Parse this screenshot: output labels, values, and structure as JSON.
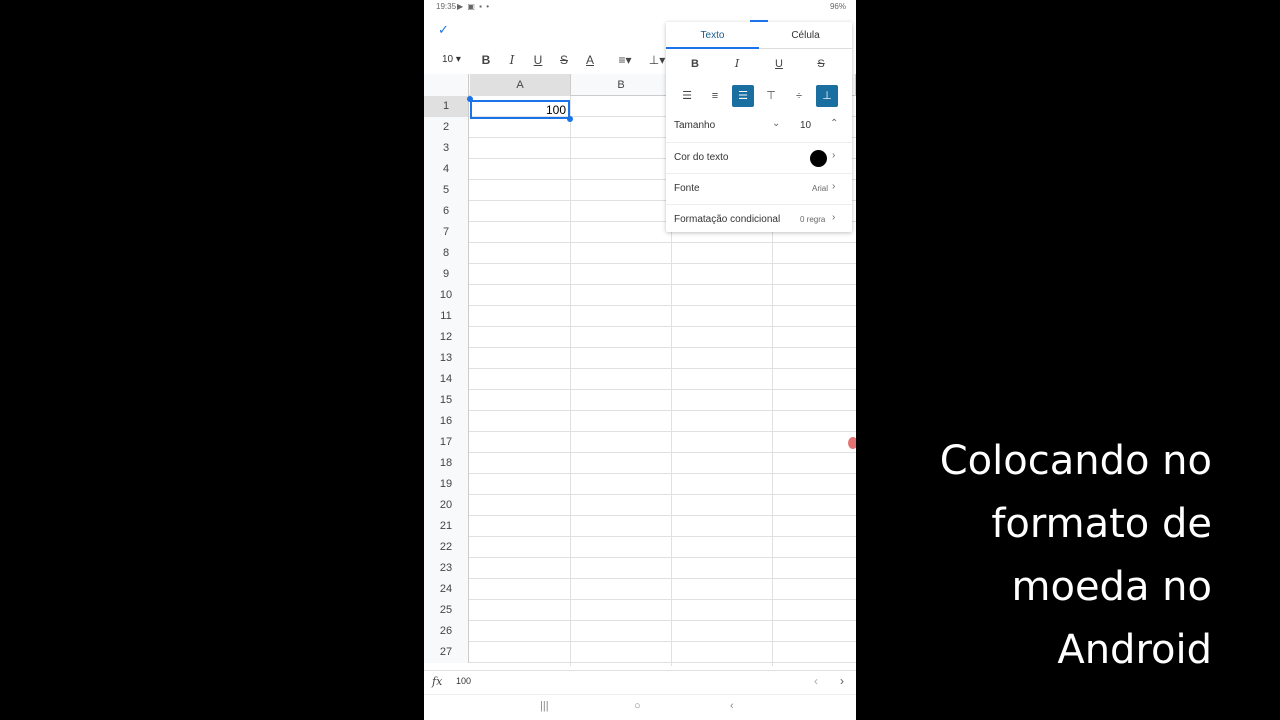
{
  "status": {
    "time": "19:35",
    "left_icons": "▶ ▣ ▪ •",
    "battery": "96%"
  },
  "toolbar": {
    "font_size": "10 ▾",
    "bold": "B",
    "italic": "I",
    "underline": "U",
    "strike": "S",
    "text_color": "A",
    "align": "≡▾",
    "valign": "⊥▾"
  },
  "columns": [
    "A",
    "B"
  ],
  "rows": [
    "1",
    "2",
    "3",
    "4",
    "5",
    "6",
    "7",
    "8",
    "9",
    "10",
    "11",
    "12",
    "13",
    "14",
    "15",
    "16",
    "17",
    "18",
    "19",
    "20",
    "21",
    "22",
    "23",
    "24",
    "25",
    "26",
    "27"
  ],
  "selected_cell": {
    "value": "100"
  },
  "panel": {
    "tab_text": "Texto",
    "tab_cell": "Célula",
    "style_buttons": {
      "bold": "B",
      "italic": "I",
      "underline": "U",
      "strike": "S"
    },
    "size_label": "Tamanho",
    "size_value": "10",
    "color_label": "Cor do texto",
    "font_label": "Fonte",
    "font_value": "Arial",
    "cond_label": "Formatação condicional",
    "cond_value": "0 regra"
  },
  "formula": {
    "fx": "fx",
    "value": "100"
  },
  "caption": [
    "Colocando no",
    "formato de",
    "moeda no",
    "Android"
  ]
}
